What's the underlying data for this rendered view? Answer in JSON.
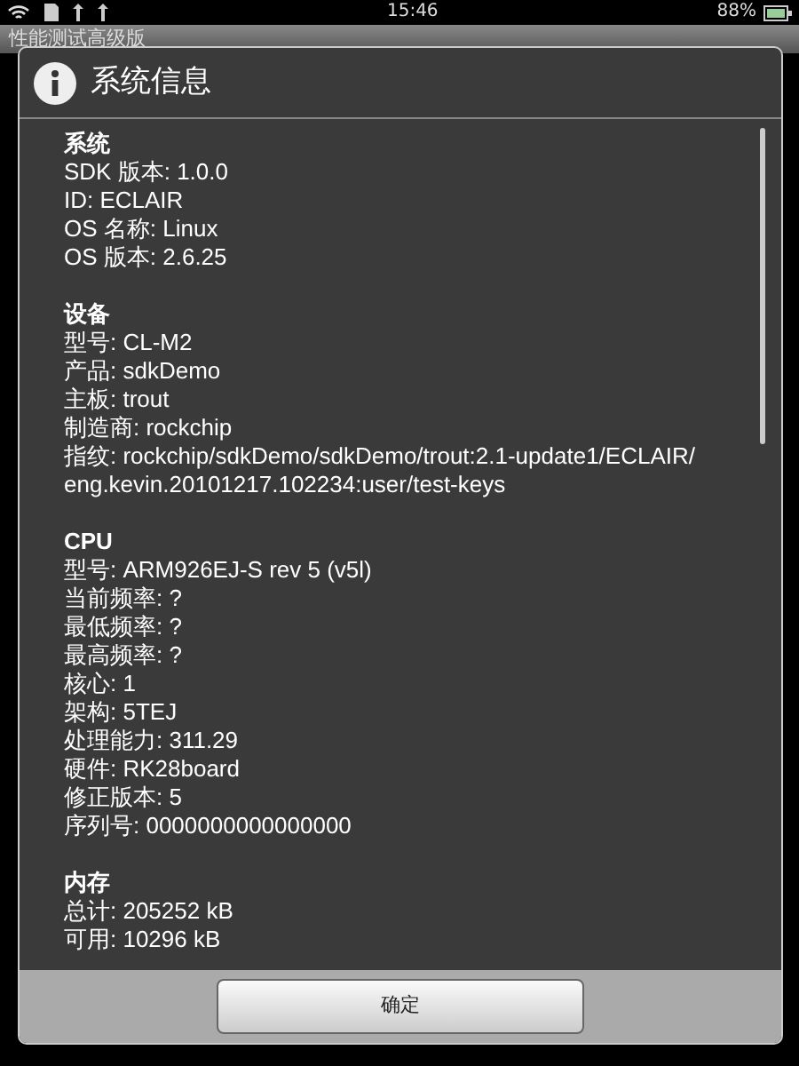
{
  "status_bar": {
    "time": "15:46",
    "battery": "88%"
  },
  "app_title": "性能测试高级版",
  "dialog": {
    "title": "系统信息",
    "sections": [
      {
        "heading": "系统",
        "lines": [
          "SDK 版本: 1.0.0",
          "ID: ECLAIR",
          "OS 名称: Linux",
          "OS 版本: 2.6.25"
        ]
      },
      {
        "heading": "设备",
        "lines": [
          "型号: CL-M2",
          "产品: sdkDemo",
          "主板: trout",
          "制造商: rockchip",
          "指纹: rockchip/sdkDemo/sdkDemo/trout:2.1-update1/ECLAIR/ eng.kevin.20101217.102234:user/test-keys"
        ]
      },
      {
        "heading": "CPU",
        "lines": [
          "型号: ARM926EJ-S rev 5 (v5l)",
          "当前频率: ?",
          "最低频率: ?",
          "最高频率: ?",
          "核心: 1",
          "架构: 5TEJ",
          "处理能力: 311.29",
          "硬件: RK28board",
          "修正版本: 5",
          "序列号: 0000000000000000"
        ]
      },
      {
        "heading": "内存",
        "lines": [
          "总计: 205252 kB",
          "可用: 10296 kB"
        ]
      }
    ],
    "button": "确定"
  }
}
